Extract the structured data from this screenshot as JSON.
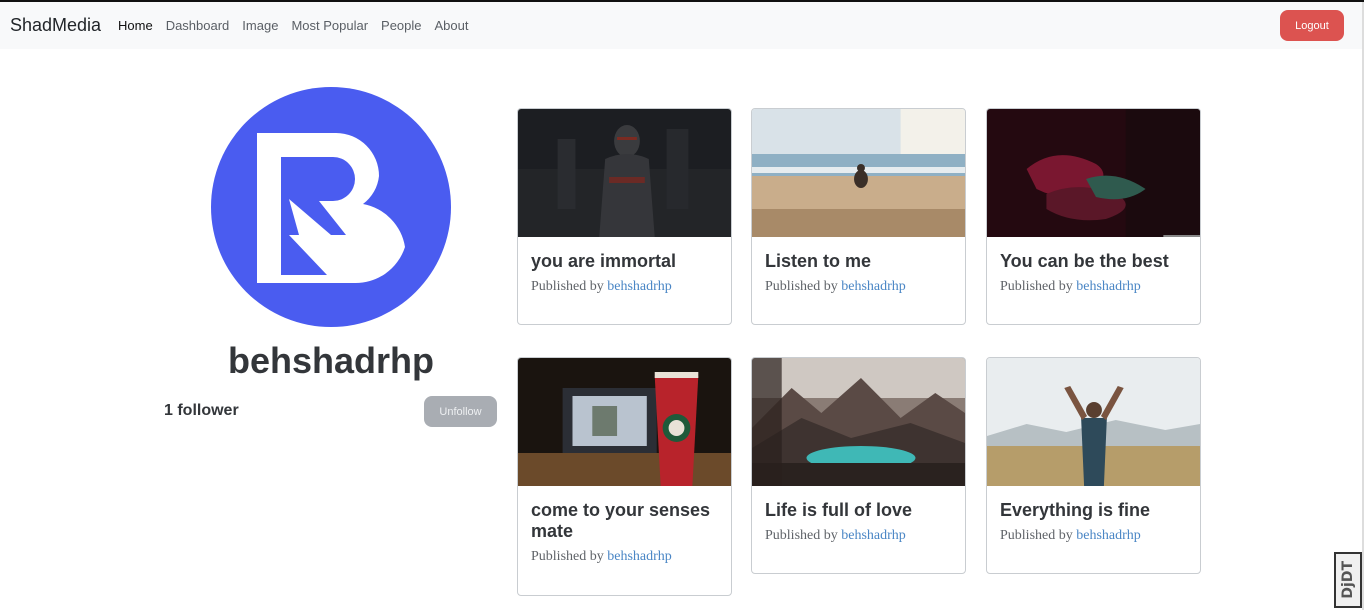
{
  "nav": {
    "brand": "ShadMedia",
    "links": [
      "Home",
      "Dashboard",
      "Image",
      "Most Popular",
      "People",
      "About"
    ],
    "logout_label": "Logout"
  },
  "profile": {
    "username": "behshadrhp",
    "followers": "1 follower",
    "follow_button": "Unfollow",
    "avatar_color": "#4a5cf0"
  },
  "posts": [
    {
      "title": "you are immortal",
      "published_prefix": "Published by",
      "author": "behshadrhp",
      "image": "dark-knight-photo"
    },
    {
      "title": "Listen to me",
      "published_prefix": "Published by",
      "author": "behshadrhp",
      "image": "beach-meditation-photo"
    },
    {
      "title": "You can be the best",
      "published_prefix": "Published by",
      "author": "behshadrhp",
      "image": "red-hands-photo"
    },
    {
      "title": "come to your senses mate",
      "published_prefix": "Published by",
      "author": "behshadrhp",
      "image": "coffee-laptop-photo"
    },
    {
      "title": "Life is full of love",
      "published_prefix": "Published by",
      "author": "behshadrhp",
      "image": "mountain-lake-photo"
    },
    {
      "title": "Everything is fine",
      "published_prefix": "Published by",
      "author": "behshadrhp",
      "image": "man-field-photo"
    }
  ],
  "debug_badge": "DjDT",
  "colors": {
    "logout": "#dc5350",
    "link": "#4a86c5",
    "unfollow": "#a9adb3"
  }
}
